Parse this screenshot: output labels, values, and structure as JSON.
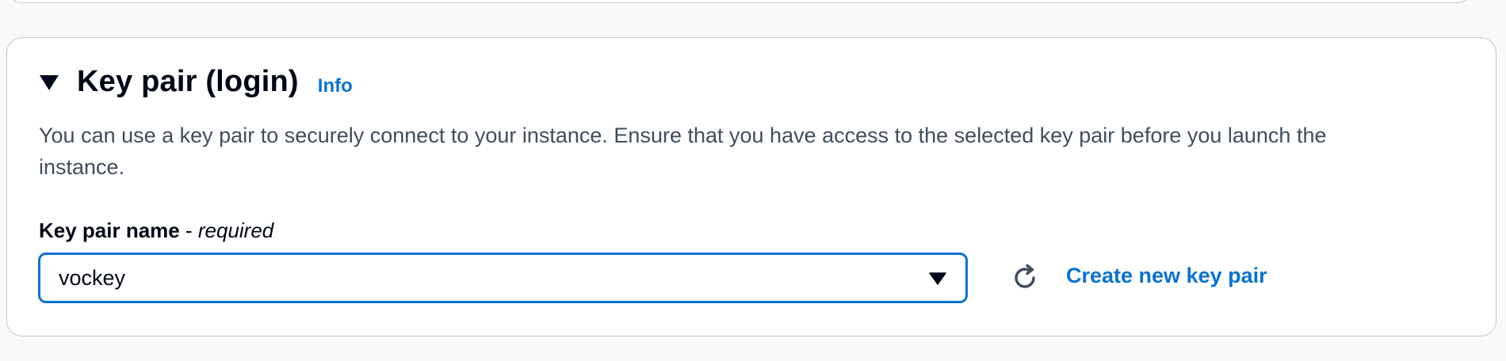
{
  "key_pair_section": {
    "title": "Key pair (login)",
    "info_label": "Info",
    "description": "You can use a key pair to securely connect to your instance. Ensure that you have access to the selected key pair before you launch the instance.",
    "field_label": "Key pair name",
    "field_separator": " - ",
    "field_required": "required",
    "selected_value": "vockey",
    "create_link_label": "Create new key pair"
  },
  "icons": {
    "section_toggle": "caret-down-icon",
    "select_caret": "caret-down-filled-icon",
    "refresh": "refresh-icon"
  },
  "colors": {
    "link": "#0972d3",
    "focus_border": "#0972d3",
    "text": "#000716",
    "secondary_text": "#414d5c",
    "panel_border": "#c6c6cd",
    "page_background": "#f9f9f9"
  }
}
